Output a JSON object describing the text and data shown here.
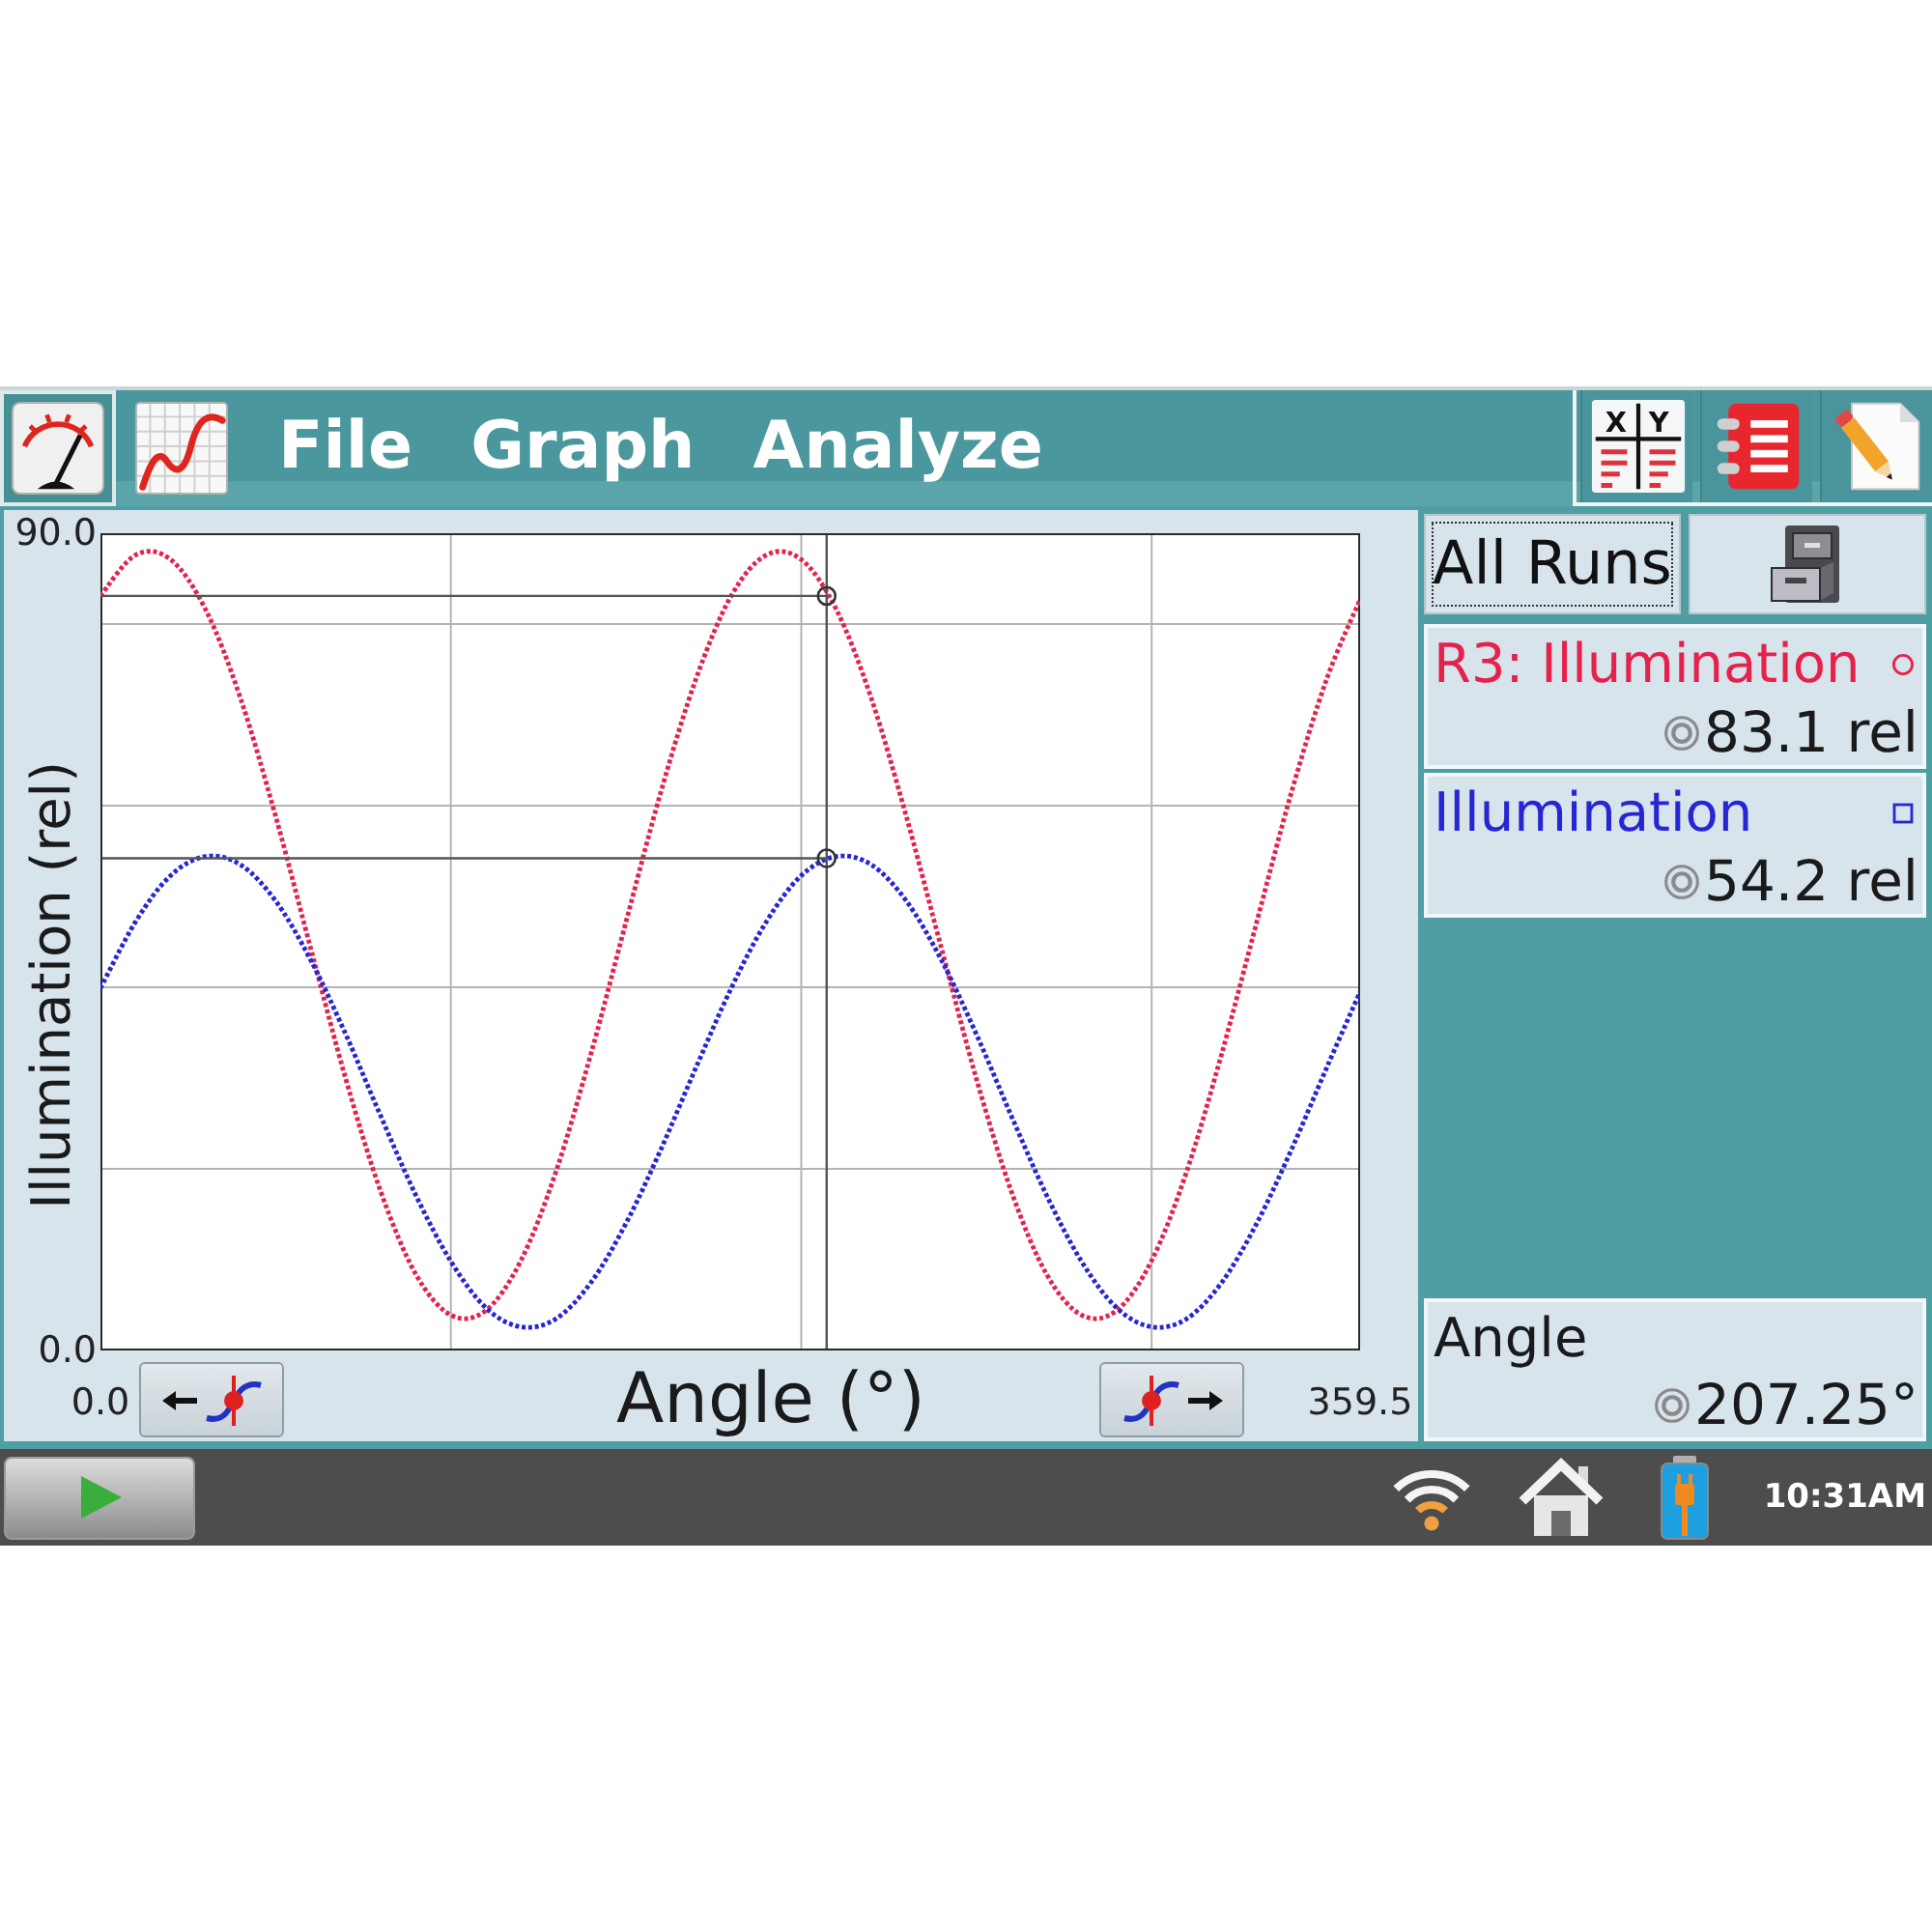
{
  "toolbar": {
    "view_tabs": [
      {
        "kind": "meter",
        "selected": true
      },
      {
        "kind": "graph",
        "selected": false
      }
    ],
    "menu": [
      "File",
      "Graph",
      "Analyze"
    ],
    "table_tool": {
      "labels": [
        "X",
        "Y"
      ]
    }
  },
  "graph": {
    "chart_data": {
      "type": "line",
      "xlabel": "Angle (°)",
      "ylabel": "Illumination (rel)",
      "x": [
        0,
        10,
        20,
        30,
        40,
        50,
        60,
        70,
        80,
        90,
        100,
        110,
        120,
        130,
        140,
        150,
        160,
        170,
        180,
        190,
        200,
        210,
        220,
        230,
        240,
        250,
        260,
        270,
        280,
        290,
        300,
        310,
        320,
        330,
        340,
        350,
        359.5
      ],
      "series": [
        {
          "color": "#e5224c",
          "line_style": "dotted",
          "values": [
            83.1,
            87.6,
            87.1,
            81.6,
            71.8,
            58.8,
            44.3,
            29.9,
            17.5,
            8.4,
            3.9,
            4.4,
            9.9,
            19.7,
            32.7,
            47.2,
            61.6,
            74.0,
            83.1,
            87.6,
            87.1,
            81.6,
            71.8,
            58.8,
            44.3,
            29.9,
            17.5,
            8.4,
            3.9,
            4.4,
            9.9,
            19.7,
            32.7,
            47.2,
            61.6,
            74.0,
            82.7
          ]
        },
        {
          "color": "#2626d4",
          "line_style": "dotted",
          "values": [
            39.9,
            47.2,
            52.3,
            54.4,
            53.5,
            49.5,
            43.0,
            34.8,
            25.8,
            17.1,
            9.8,
            4.7,
            2.6,
            3.5,
            7.5,
            14.0,
            22.2,
            31.2,
            39.9,
            47.2,
            52.3,
            54.4,
            53.5,
            49.5,
            43.0,
            34.8,
            25.8,
            17.1,
            9.8,
            4.7,
            2.6,
            3.5,
            7.5,
            14.0,
            22.2,
            31.2,
            39.5
          ]
        }
      ],
      "xlim": [
        0,
        359.5
      ],
      "ylim": [
        0,
        90
      ],
      "xticks": [
        {
          "value": 0,
          "label": "0.0"
        },
        {
          "value": 359.5,
          "label": "359.5"
        }
      ],
      "yticks": [
        {
          "value": 0,
          "label": "0.0"
        },
        {
          "value": 90,
          "label": "90.0"
        }
      ],
      "ref_lines": [
        {
          "axis": "x",
          "value": 207.25
        },
        {
          "axis": "y",
          "value": 83.1
        },
        {
          "axis": "y",
          "value": 54.2
        }
      ]
    }
  },
  "side_panel": {
    "runs_button": {
      "label": "All Runs",
      "focused": true
    },
    "meters": [
      {
        "name": "R3: Illumination",
        "color": "#e5224c",
        "kind": "circle",
        "value": "83.1 rel"
      },
      {
        "name": "Illumination",
        "color": "#2626d4",
        "kind": "square",
        "value": "54.2 rel"
      }
    ],
    "x_meter": {
      "name": "Angle",
      "value": "207.25°"
    }
  },
  "status_bar": {
    "time": "10:31AM"
  }
}
